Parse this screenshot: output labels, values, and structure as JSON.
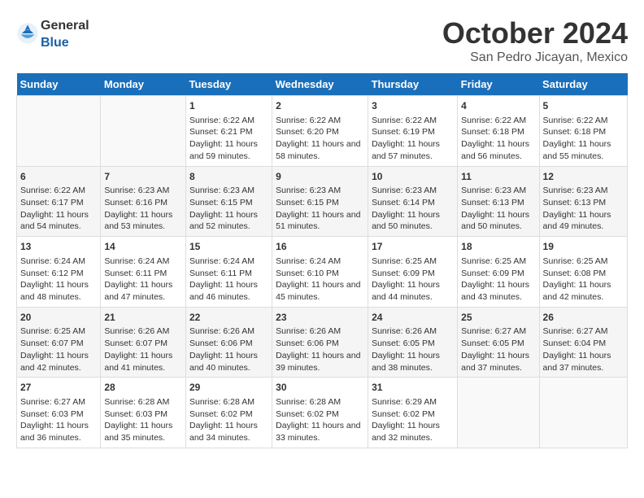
{
  "header": {
    "logo_general": "General",
    "logo_blue": "Blue",
    "month_title": "October 2024",
    "location": "San Pedro Jicayan, Mexico"
  },
  "weekdays": [
    "Sunday",
    "Monday",
    "Tuesday",
    "Wednesday",
    "Thursday",
    "Friday",
    "Saturday"
  ],
  "weeks": [
    [
      {
        "day": "",
        "content": ""
      },
      {
        "day": "",
        "content": ""
      },
      {
        "day": "1",
        "content": "Sunrise: 6:22 AM\nSunset: 6:21 PM\nDaylight: 11 hours and 59 minutes."
      },
      {
        "day": "2",
        "content": "Sunrise: 6:22 AM\nSunset: 6:20 PM\nDaylight: 11 hours and 58 minutes."
      },
      {
        "day": "3",
        "content": "Sunrise: 6:22 AM\nSunset: 6:19 PM\nDaylight: 11 hours and 57 minutes."
      },
      {
        "day": "4",
        "content": "Sunrise: 6:22 AM\nSunset: 6:18 PM\nDaylight: 11 hours and 56 minutes."
      },
      {
        "day": "5",
        "content": "Sunrise: 6:22 AM\nSunset: 6:18 PM\nDaylight: 11 hours and 55 minutes."
      }
    ],
    [
      {
        "day": "6",
        "content": "Sunrise: 6:22 AM\nSunset: 6:17 PM\nDaylight: 11 hours and 54 minutes."
      },
      {
        "day": "7",
        "content": "Sunrise: 6:23 AM\nSunset: 6:16 PM\nDaylight: 11 hours and 53 minutes."
      },
      {
        "day": "8",
        "content": "Sunrise: 6:23 AM\nSunset: 6:15 PM\nDaylight: 11 hours and 52 minutes."
      },
      {
        "day": "9",
        "content": "Sunrise: 6:23 AM\nSunset: 6:15 PM\nDaylight: 11 hours and 51 minutes."
      },
      {
        "day": "10",
        "content": "Sunrise: 6:23 AM\nSunset: 6:14 PM\nDaylight: 11 hours and 50 minutes."
      },
      {
        "day": "11",
        "content": "Sunrise: 6:23 AM\nSunset: 6:13 PM\nDaylight: 11 hours and 50 minutes."
      },
      {
        "day": "12",
        "content": "Sunrise: 6:23 AM\nSunset: 6:13 PM\nDaylight: 11 hours and 49 minutes."
      }
    ],
    [
      {
        "day": "13",
        "content": "Sunrise: 6:24 AM\nSunset: 6:12 PM\nDaylight: 11 hours and 48 minutes."
      },
      {
        "day": "14",
        "content": "Sunrise: 6:24 AM\nSunset: 6:11 PM\nDaylight: 11 hours and 47 minutes."
      },
      {
        "day": "15",
        "content": "Sunrise: 6:24 AM\nSunset: 6:11 PM\nDaylight: 11 hours and 46 minutes."
      },
      {
        "day": "16",
        "content": "Sunrise: 6:24 AM\nSunset: 6:10 PM\nDaylight: 11 hours and 45 minutes."
      },
      {
        "day": "17",
        "content": "Sunrise: 6:25 AM\nSunset: 6:09 PM\nDaylight: 11 hours and 44 minutes."
      },
      {
        "day": "18",
        "content": "Sunrise: 6:25 AM\nSunset: 6:09 PM\nDaylight: 11 hours and 43 minutes."
      },
      {
        "day": "19",
        "content": "Sunrise: 6:25 AM\nSunset: 6:08 PM\nDaylight: 11 hours and 42 minutes."
      }
    ],
    [
      {
        "day": "20",
        "content": "Sunrise: 6:25 AM\nSunset: 6:07 PM\nDaylight: 11 hours and 42 minutes."
      },
      {
        "day": "21",
        "content": "Sunrise: 6:26 AM\nSunset: 6:07 PM\nDaylight: 11 hours and 41 minutes."
      },
      {
        "day": "22",
        "content": "Sunrise: 6:26 AM\nSunset: 6:06 PM\nDaylight: 11 hours and 40 minutes."
      },
      {
        "day": "23",
        "content": "Sunrise: 6:26 AM\nSunset: 6:06 PM\nDaylight: 11 hours and 39 minutes."
      },
      {
        "day": "24",
        "content": "Sunrise: 6:26 AM\nSunset: 6:05 PM\nDaylight: 11 hours and 38 minutes."
      },
      {
        "day": "25",
        "content": "Sunrise: 6:27 AM\nSunset: 6:05 PM\nDaylight: 11 hours and 37 minutes."
      },
      {
        "day": "26",
        "content": "Sunrise: 6:27 AM\nSunset: 6:04 PM\nDaylight: 11 hours and 37 minutes."
      }
    ],
    [
      {
        "day": "27",
        "content": "Sunrise: 6:27 AM\nSunset: 6:03 PM\nDaylight: 11 hours and 36 minutes."
      },
      {
        "day": "28",
        "content": "Sunrise: 6:28 AM\nSunset: 6:03 PM\nDaylight: 11 hours and 35 minutes."
      },
      {
        "day": "29",
        "content": "Sunrise: 6:28 AM\nSunset: 6:02 PM\nDaylight: 11 hours and 34 minutes."
      },
      {
        "day": "30",
        "content": "Sunrise: 6:28 AM\nSunset: 6:02 PM\nDaylight: 11 hours and 33 minutes."
      },
      {
        "day": "31",
        "content": "Sunrise: 6:29 AM\nSunset: 6:02 PM\nDaylight: 11 hours and 32 minutes."
      },
      {
        "day": "",
        "content": ""
      },
      {
        "day": "",
        "content": ""
      }
    ]
  ]
}
